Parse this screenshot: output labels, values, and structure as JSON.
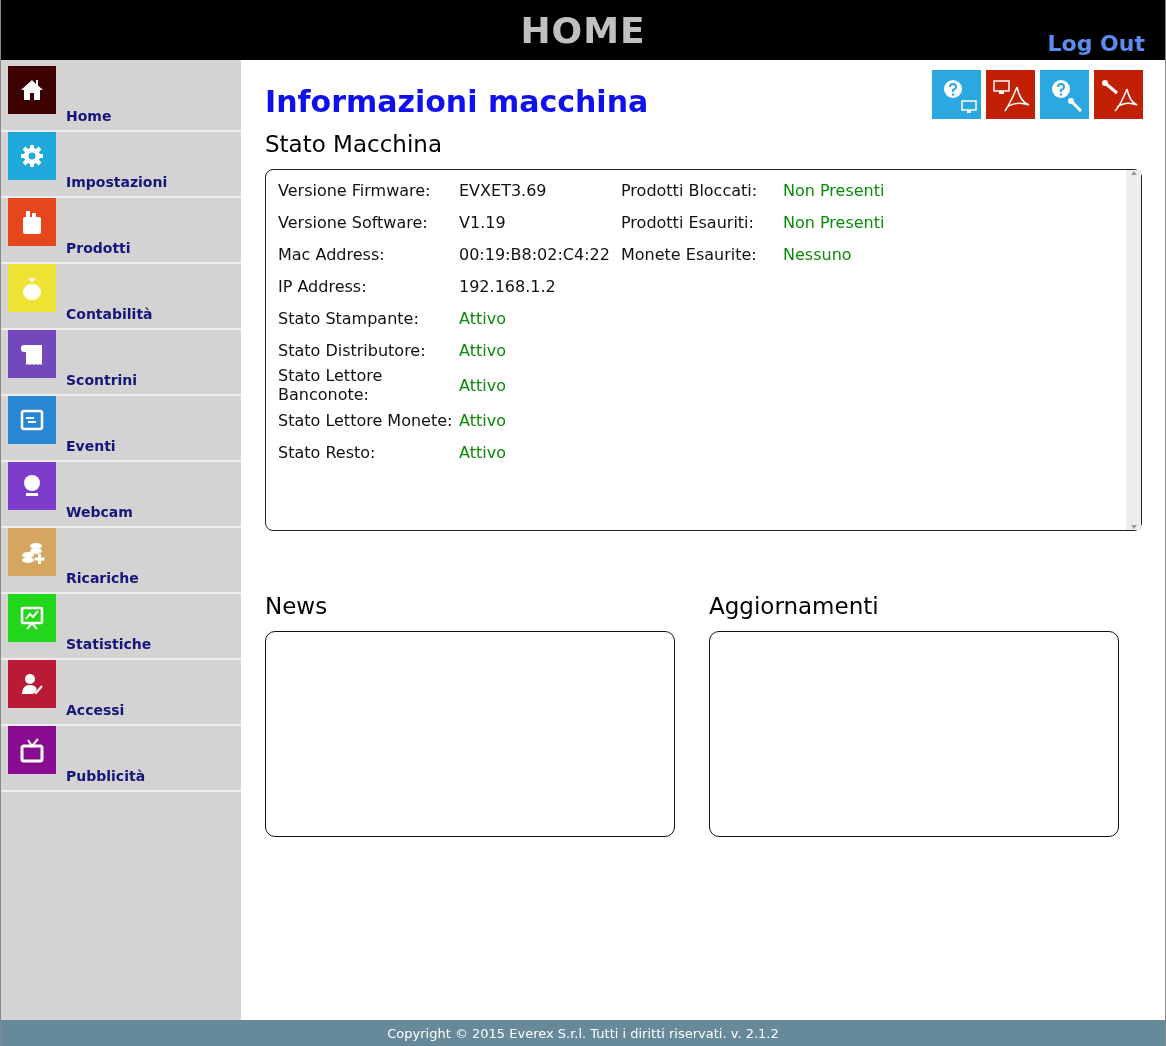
{
  "header": {
    "title": "HOME",
    "logout": "Log Out"
  },
  "sidebar": {
    "items": [
      {
        "label": "Home",
        "color": "#3d0000"
      },
      {
        "label": "Impostazioni",
        "color": "#1fa8dc"
      },
      {
        "label": "Prodotti",
        "color": "#e5461b"
      },
      {
        "label": "Contabilità",
        "color": "#efe436"
      },
      {
        "label": "Scontrini",
        "color": "#7448bd"
      },
      {
        "label": "Eventi",
        "color": "#2a87d4"
      },
      {
        "label": "Webcam",
        "color": "#7d3ccc"
      },
      {
        "label": "Ricariche",
        "color": "#d4a660"
      },
      {
        "label": "Statistiche",
        "color": "#22d61c"
      },
      {
        "label": "Accessi",
        "color": "#bb1a36"
      },
      {
        "label": "Pubblicità",
        "color": "#8a0c91"
      }
    ]
  },
  "page_title": "Informazioni macchina",
  "machine": {
    "title": "Stato Macchina",
    "left": [
      {
        "label": "Versione Firmware:",
        "value": "EVXET3.69",
        "kind": "text"
      },
      {
        "label": "Versione Software:",
        "value": "V1.19",
        "kind": "text"
      },
      {
        "label": "Mac Address:",
        "value": "00:19:B8:02:C4:22",
        "kind": "text"
      },
      {
        "label": "IP Address:",
        "value": "192.168.1.2",
        "kind": "text"
      },
      {
        "label": "Stato Stampante:",
        "value": "Attivo",
        "kind": "status"
      },
      {
        "label": "Stato Distributore:",
        "value": "Attivo",
        "kind": "status"
      },
      {
        "label": "Stato Lettore Banconote:",
        "value": "Attivo",
        "kind": "status"
      },
      {
        "label": "Stato Lettore Monete:",
        "value": "Attivo",
        "kind": "status"
      },
      {
        "label": "Stato Resto:",
        "value": "Attivo",
        "kind": "status"
      }
    ],
    "right": [
      {
        "label": "Prodotti Bloccati:",
        "value": "Non Presenti",
        "kind": "status"
      },
      {
        "label": "Prodotti Esauriti:",
        "value": "Non Presenti",
        "kind": "status"
      },
      {
        "label": "Monete Esaurite:",
        "value": "Nessuno",
        "kind": "status"
      }
    ]
  },
  "news": {
    "title": "News"
  },
  "updates": {
    "title": "Aggiornamenti"
  },
  "footer": "Copyright © 2015 Everex S.r.l. Tutti i diritti riservati. v. 2.1.2"
}
